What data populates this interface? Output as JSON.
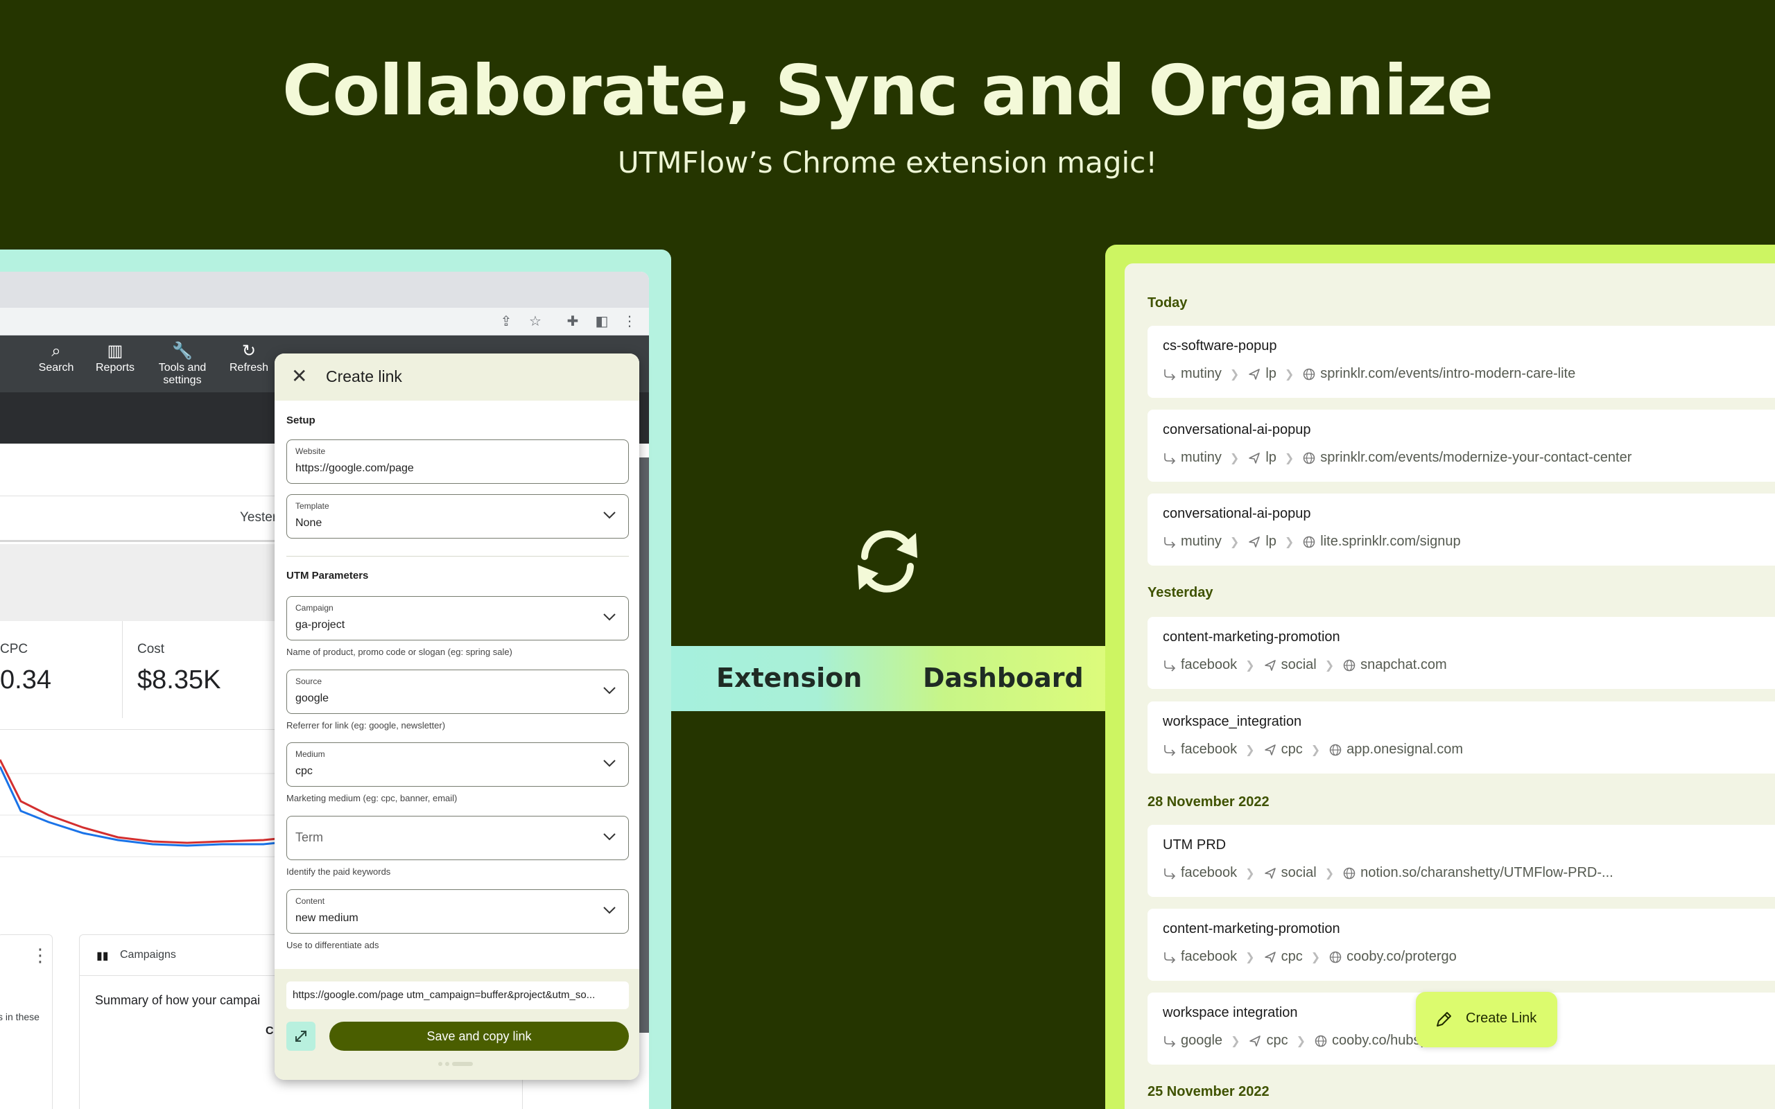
{
  "hero": {
    "title": "Collaborate, Sync and Organize",
    "subtitle": "UTMFlow’s Chrome extension magic!"
  },
  "bridge": {
    "left_label": "Extension",
    "right_label": "Dashboard"
  },
  "gads": {
    "tools": [
      {
        "icon": "search-icon",
        "label": "Search"
      },
      {
        "icon": "reports-icon",
        "label": "Reports"
      },
      {
        "icon": "wrench-icon",
        "label": "Tools and settings"
      },
      {
        "icon": "refresh-icon",
        "label": "Refresh"
      }
    ],
    "date_partial": "Yester",
    "stats": [
      {
        "label": "CPC",
        "value": "0.34"
      },
      {
        "label": "Cost",
        "value": "$8.35K"
      }
    ],
    "campaigns_title": "Campaigns",
    "campaigns_summary": "Summary of how your campai",
    "left_note": "s in these",
    "cut_c": "C"
  },
  "panel": {
    "title": "Create link",
    "setup_label": "Setup",
    "website": {
      "label": "Website",
      "value": "https://google.com/page"
    },
    "template": {
      "label": "Template",
      "value": "None"
    },
    "utm_label": "UTM Parameters",
    "campaign": {
      "label": "Campaign",
      "value": "ga-project",
      "helper": "Name of product, promo code or slogan (eg: spring sale)"
    },
    "source": {
      "label": "Source",
      "value": "google",
      "helper": "Referrer for link (eg: google, newsletter)"
    },
    "medium": {
      "label": "Medium",
      "value": "cpc",
      "helper": "Marketing medium (eg: cpc, banner, email)"
    },
    "term": {
      "placeholder": "Term",
      "helper": "Identify the paid keywords"
    },
    "content": {
      "label": "Content",
      "value": "new medium",
      "helper": "Use to differentiate ads"
    },
    "generated_url": "https://google.com/page utm_campaign=buffer&project&utm_so...",
    "save_label": "Save and copy link"
  },
  "dashboard": {
    "groups": [
      {
        "label": "Today",
        "entries": [
          {
            "name": "cs-software-popup",
            "source": "mutiny",
            "medium": "lp",
            "url": "sprinklr.com/events/intro-modern-care-lite"
          },
          {
            "name": "conversational-ai-popup",
            "source": "mutiny",
            "medium": "lp",
            "url": "sprinklr.com/events/modernize-your-contact-center"
          },
          {
            "name": "conversational-ai-popup",
            "source": "mutiny",
            "medium": "lp",
            "url": "lite.sprinklr.com/signup"
          }
        ]
      },
      {
        "label": "Yesterday",
        "entries": [
          {
            "name": "content-marketing-promotion",
            "source": "facebook",
            "medium": "social",
            "url": "snapchat.com"
          },
          {
            "name": "workspace_integration",
            "source": "facebook",
            "medium": "cpc",
            "url": "app.onesignal.com"
          }
        ]
      },
      {
        "label": "28 November 2022",
        "entries": [
          {
            "name": "UTM PRD",
            "source": "facebook",
            "medium": "social",
            "url": "notion.so/charanshetty/UTMFlow-PRD-..."
          },
          {
            "name": "content-marketing-promotion",
            "source": "facebook",
            "medium": "cpc",
            "url": "cooby.co/protergo"
          },
          {
            "name": "workspace integration",
            "source": "google",
            "medium": "cpc",
            "url": "cooby.co/hubspot-integration"
          }
        ]
      },
      {
        "label": "25 November 2022",
        "entries": []
      }
    ],
    "create_link_label": "Create Link"
  }
}
